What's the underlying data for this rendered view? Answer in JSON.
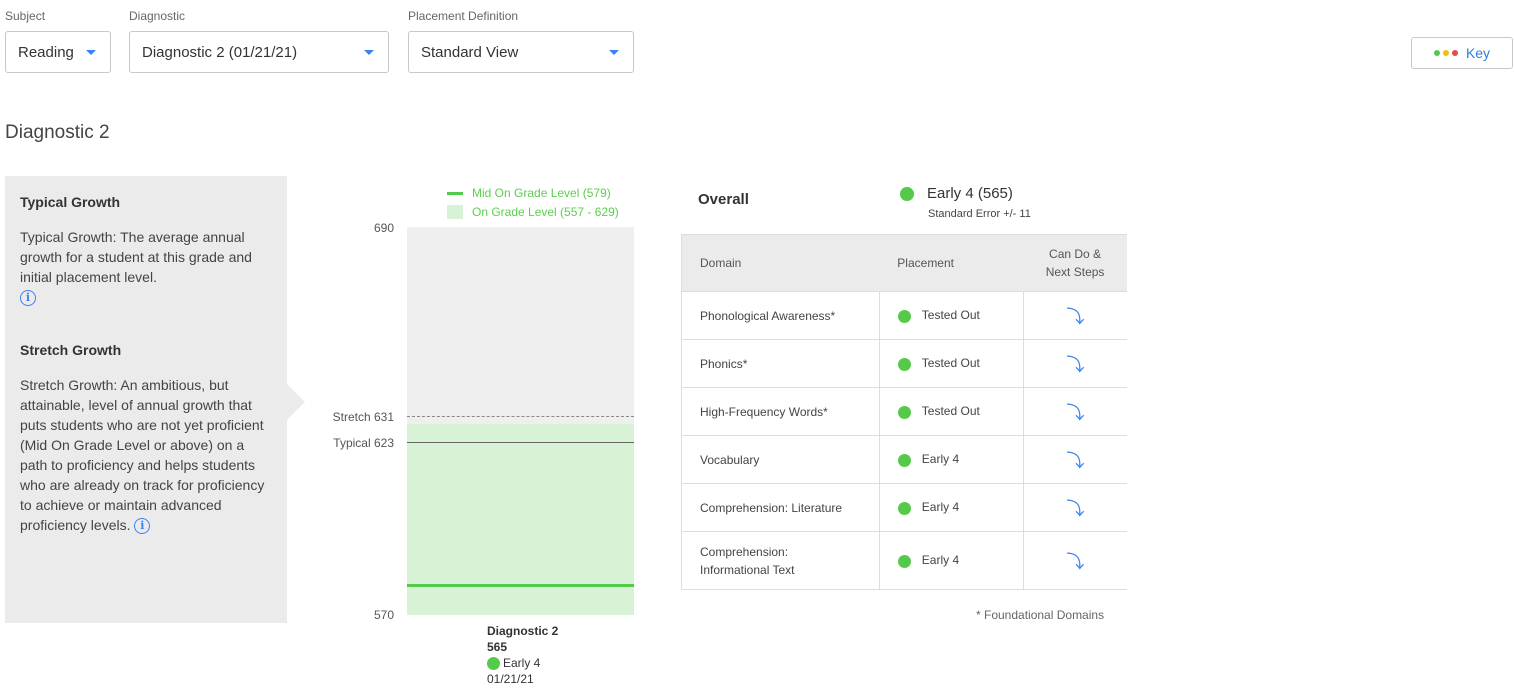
{
  "filters": {
    "subject": {
      "label": "Subject",
      "value": "Reading"
    },
    "diagnostic": {
      "label": "Diagnostic",
      "value": "Diagnostic 2 (01/21/21)"
    },
    "placement": {
      "label": "Placement Definition",
      "value": "Standard View"
    }
  },
  "key_button": {
    "label": "Key",
    "dot_colors": [
      "#55c94a",
      "#f2c200",
      "#e8474c"
    ]
  },
  "page_title": "Diagnostic 2",
  "info_panel": {
    "typical": {
      "heading": "Typical Growth",
      "text": "Typical Growth: The average annual growth for a student at this grade and initial placement level."
    },
    "stretch": {
      "heading": "Stretch Growth",
      "text": "Stretch Growth: An ambitious, but attainable, level of annual growth that puts students who are not yet proficient (Mid On Grade Level or above) on a path to proficiency and helps students who are already on track for proficiency to achieve or maintain advanced proficiency levels."
    },
    "info_glyph": "i"
  },
  "chart": {
    "legend": {
      "mid": "Mid On Grade Level (579)",
      "on_grade": "On Grade Level (557 - 629)"
    },
    "axis": {
      "top": "690",
      "bottom": "570"
    },
    "stretch_label": "Stretch 631",
    "typical_label": "Typical 623",
    "colors": {
      "mid_line": "#55c94a",
      "band": "#d8f2d6",
      "background": "#efefef"
    },
    "x_label": {
      "name": "Diagnostic 2",
      "score": "565",
      "placement": "Early 4",
      "date": "01/21/21"
    }
  },
  "chart_data": {
    "type": "bar",
    "title": "",
    "ylim": [
      570,
      690
    ],
    "categories": [
      "Diagnostic 2"
    ],
    "values": [
      565
    ],
    "reference_lines": [
      {
        "name": "Stretch",
        "value": 631,
        "style": "dashed"
      },
      {
        "name": "Typical",
        "value": 623,
        "style": "solid"
      },
      {
        "name": "Mid On Grade Level",
        "value": 579
      }
    ],
    "bands": [
      {
        "name": "On Grade Level",
        "range": [
          557,
          629
        ]
      }
    ]
  },
  "overall": {
    "title": "Overall",
    "value": "Early 4 (565)",
    "standard_error": "Standard Error +/- 11",
    "color": "#55c94a"
  },
  "table": {
    "headers": {
      "domain": "Domain",
      "placement": "Placement",
      "cando_line1": "Can Do &",
      "cando_line2": "Next Steps"
    },
    "rows": [
      {
        "domain": "Phonological Awareness*",
        "placement": "Tested Out"
      },
      {
        "domain": "Phonics*",
        "placement": "Tested Out"
      },
      {
        "domain": "High-Frequency Words*",
        "placement": "Tested Out"
      },
      {
        "domain": "Vocabulary",
        "placement": "Early 4"
      },
      {
        "domain": "Comprehension: Literature",
        "placement": "Early 4"
      },
      {
        "domain_line1": "Comprehension:",
        "domain_line2": "Informational Text",
        "placement": "Early 4"
      }
    ],
    "arrow_icon": "⤵"
  },
  "footnote": "* Foundational Domains"
}
